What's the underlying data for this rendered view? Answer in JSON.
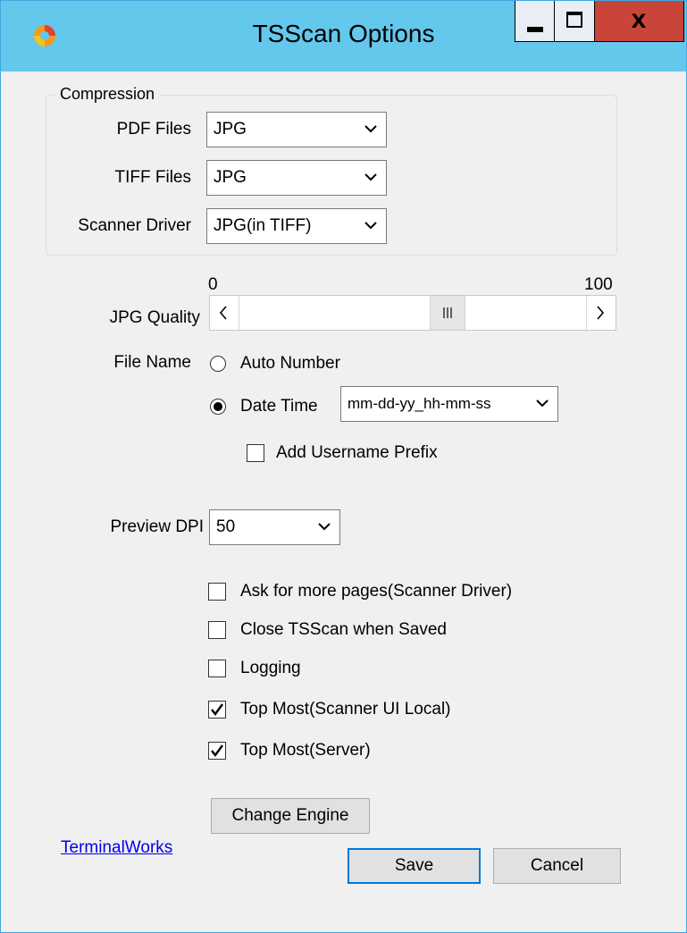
{
  "window": {
    "title": "TSScan Options",
    "close_label": "x"
  },
  "compression": {
    "legend": "Compression",
    "pdf_label": "PDF Files",
    "pdf_value": "JPG",
    "tiff_label": "TIFF Files",
    "tiff_value": "JPG",
    "driver_label": "Scanner Driver",
    "driver_value": "JPG(in TIFF)"
  },
  "jpg_quality": {
    "label": "JPG Quality",
    "min_label": "0",
    "max_label": "100",
    "min": 0,
    "max": 100,
    "value": 61
  },
  "file_name": {
    "label": "File Name",
    "auto_number_label": "Auto Number",
    "date_time_label": "Date Time",
    "date_time_format": "mm-dd-yy_hh-mm-ss",
    "selected": "date_time",
    "username_prefix_label": "Add Username Prefix",
    "username_prefix_checked": false
  },
  "preview_dpi": {
    "label": "Preview DPI",
    "value": "50"
  },
  "options": [
    {
      "label": "Ask for more pages(Scanner Driver)",
      "checked": false
    },
    {
      "label": "Close TSScan when Saved",
      "checked": false
    },
    {
      "label": "Logging",
      "checked": false
    },
    {
      "label": "Top Most(Scanner UI Local)",
      "checked": true
    },
    {
      "label": "Top Most(Server)",
      "checked": true
    }
  ],
  "buttons": {
    "change_engine": "Change Engine",
    "save": "Save",
    "cancel": "Cancel"
  },
  "link": {
    "text": "TerminalWorks"
  },
  "colors": {
    "titlebar": "#64c7ec",
    "close_button": "#c9453a",
    "link": "#0000ee"
  }
}
